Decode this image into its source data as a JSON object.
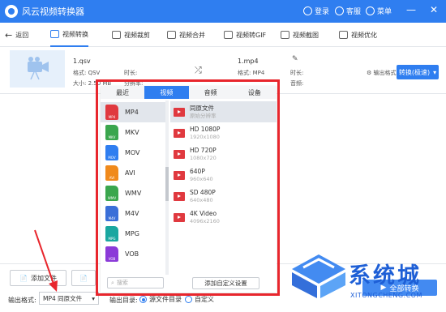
{
  "app": {
    "title": "风云视频转换器",
    "accent": "#2f7ef0"
  },
  "titlebar": {
    "login": "登录",
    "service": "客服",
    "menu": "菜单",
    "minimize": "—",
    "close": "✕"
  },
  "nav": {
    "back": "返回",
    "tabs": [
      "视频转换",
      "视频裁剪",
      "视频合并",
      "视频转GIF",
      "视频截图",
      "视频优化"
    ]
  },
  "file": {
    "source_name": "1.qsv",
    "source_format": "格式: QSV",
    "source_size": "大小: 2.50 MB",
    "source_duration": "时长:",
    "source_resolution": "分辨率:",
    "target_name": "1.mp4",
    "target_format": "格式: MP4",
    "target_duration": "时长:",
    "target_audio": "音频:",
    "output_format_btn": "输出格式",
    "convert_btn": "转换(极速)"
  },
  "panel": {
    "tabs": [
      "最近",
      "视频",
      "音频",
      "设备"
    ],
    "active_tab": 1,
    "formats": [
      "MP4",
      "MKV",
      "MOV",
      "AVI",
      "WMV",
      "M4V",
      "MPG",
      "VOB"
    ],
    "format_colors": [
      "#e0393f",
      "#3aa64d",
      "#2f7ef0",
      "#f08a1c",
      "#3aa64d",
      "#3a6fd8",
      "#1aa7a0",
      "#8b3ad8"
    ],
    "search_placeholder": "搜索",
    "qualities": [
      {
        "name": "同原文件",
        "sub": "原始分辨率"
      },
      {
        "name": "HD 1080P",
        "sub": "1920x1080"
      },
      {
        "name": "HD 720P",
        "sub": "1080x720"
      },
      {
        "name": "640P",
        "sub": "960x640"
      },
      {
        "name": "SD 480P",
        "sub": "640x480"
      },
      {
        "name": "4K Video",
        "sub": "4096x2160"
      }
    ],
    "custom_btn": "添加自定义设置"
  },
  "bottom": {
    "add_file": "添加文件",
    "output_format_label": "输出格式:",
    "output_format_value": "MP4 同原文件",
    "output_dir_label": "输出目录:",
    "dir_option_source": "源文件目录",
    "dir_option_custom": "自定义",
    "convert_all": "全部转换"
  },
  "watermark": {
    "text": "系统城",
    "url": "XITONGCHENG.COM"
  }
}
